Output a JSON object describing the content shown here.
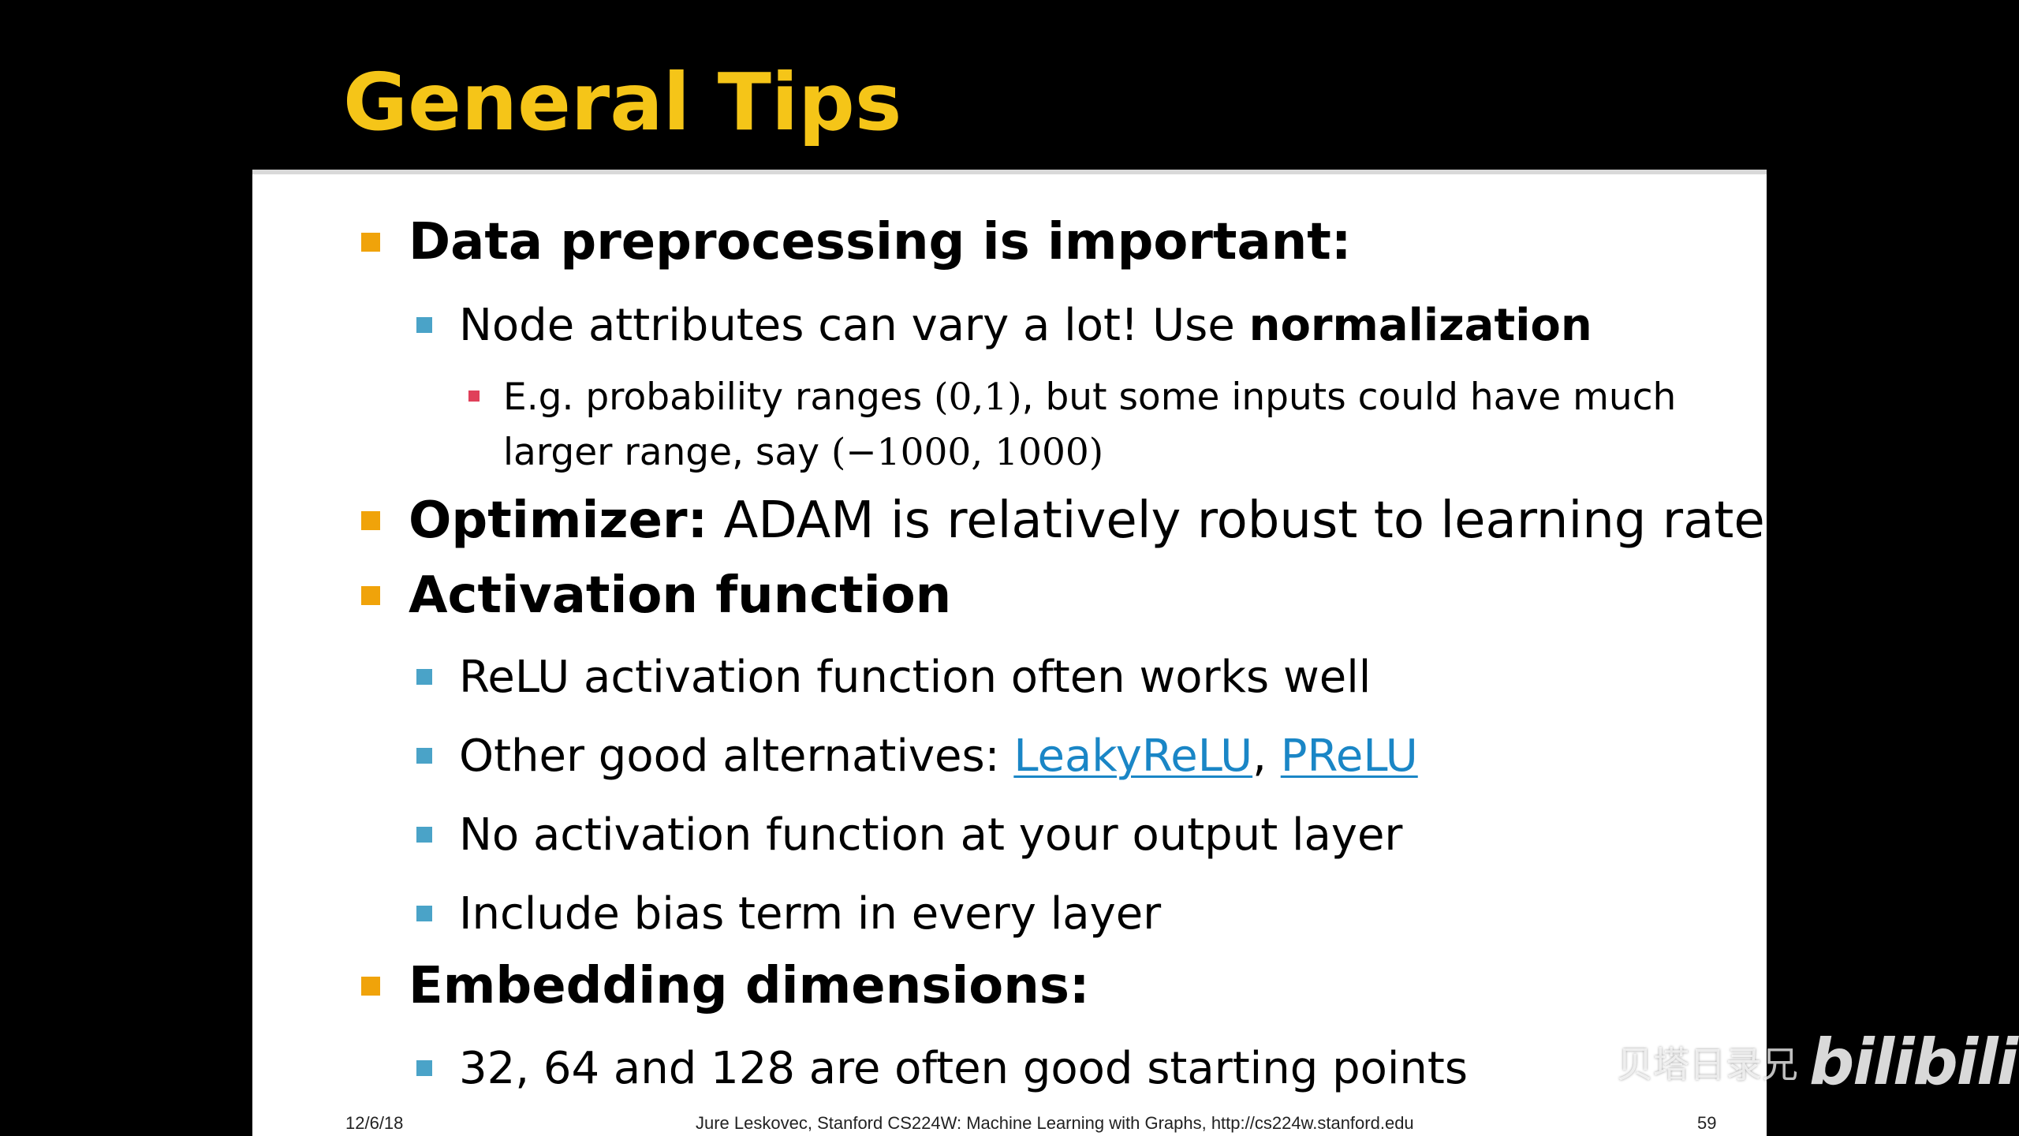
{
  "slide": {
    "title": "General Tips",
    "colors": {
      "background": "#000000",
      "title": "#f5c518",
      "panel": "#ffffff",
      "bullet_level1": "#f0a30a",
      "bullet_level2": "#4aa3c8",
      "bullet_level3": "#e0405a",
      "link": "#1a86c6"
    },
    "items": {
      "data_pre": {
        "label": "Data preprocessing is important:",
        "normalization": {
          "text": "Node attributes can vary a lot! Use ",
          "bold": "normalization"
        },
        "example": {
          "line1_a": "E.g. probability ranges ",
          "line1_math": "(0,1)",
          "line1_b": ", but some inputs could have much",
          "line2_a": "larger range, say ",
          "line2_math": "(−1000, 1000)"
        }
      },
      "optimizer": {
        "label": "Optimizer:",
        "text": " ADAM is relatively robust to learning rate"
      },
      "activation": {
        "label": "Activation function",
        "relu": "ReLU activation function often works well",
        "alternatives": {
          "text": "Other good alternatives: ",
          "link1": "LeakyReLU",
          "sep": ", ",
          "link2": "PReLU"
        },
        "no_output": "No activation function at your output layer",
        "bias": "Include bias term in every layer"
      },
      "embedding": {
        "label": "Embedding dimensions:",
        "dims": "32, 64 and 128 are often good starting points"
      }
    },
    "footer": {
      "date": "12/6/18",
      "credit": "Jure Leskovec, Stanford CS224W: Machine Learning with Graphs, http://cs224w.stanford.edu",
      "page": "59"
    },
    "watermark": {
      "text": "贝塔日录兄",
      "logo": "bilibili"
    }
  }
}
